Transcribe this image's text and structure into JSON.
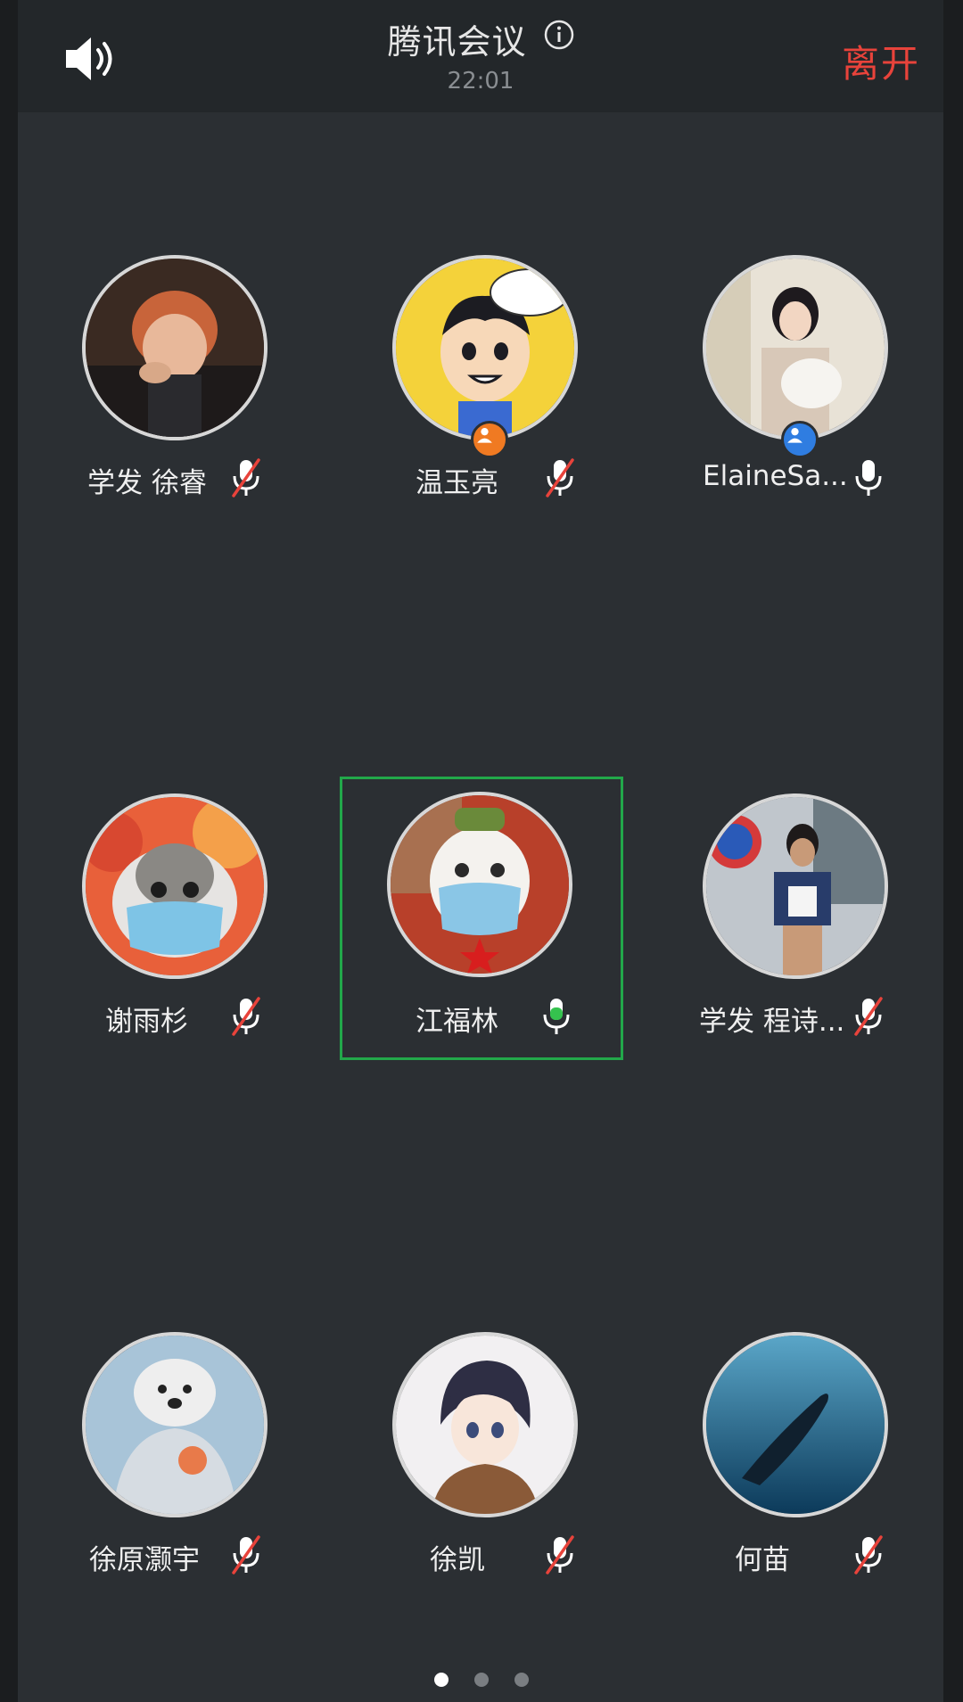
{
  "header": {
    "title": "腾讯会议",
    "time": "22:01",
    "leave_label": "离开"
  },
  "participants": [
    {
      "name": "学发 徐睿",
      "mic": "muted"
    },
    {
      "name": "温玉亮",
      "mic": "muted",
      "badge": "host"
    },
    {
      "name": "ElaineSa...",
      "mic": "on",
      "badge": "cohost"
    },
    {
      "name": "谢雨杉",
      "mic": "muted"
    },
    {
      "name": "江福林",
      "mic": "speaking",
      "active": true
    },
    {
      "name": "学发 程诗...",
      "mic": "muted"
    },
    {
      "name": "徐原灏宇",
      "mic": "muted"
    },
    {
      "name": "徐凯",
      "mic": "muted"
    },
    {
      "name": "何苗",
      "mic": "muted"
    }
  ],
  "pagination": {
    "pages": 3,
    "current": 1
  },
  "colors": {
    "accent_green": "#22a84a",
    "leave_red": "#e8433b",
    "host_badge": "#f07a22",
    "cohost_badge": "#2f7de1"
  },
  "icons": {
    "speaker": "speaker-icon",
    "info": "info-icon",
    "mic_muted": "mic-muted-icon",
    "mic_on": "mic-icon"
  }
}
